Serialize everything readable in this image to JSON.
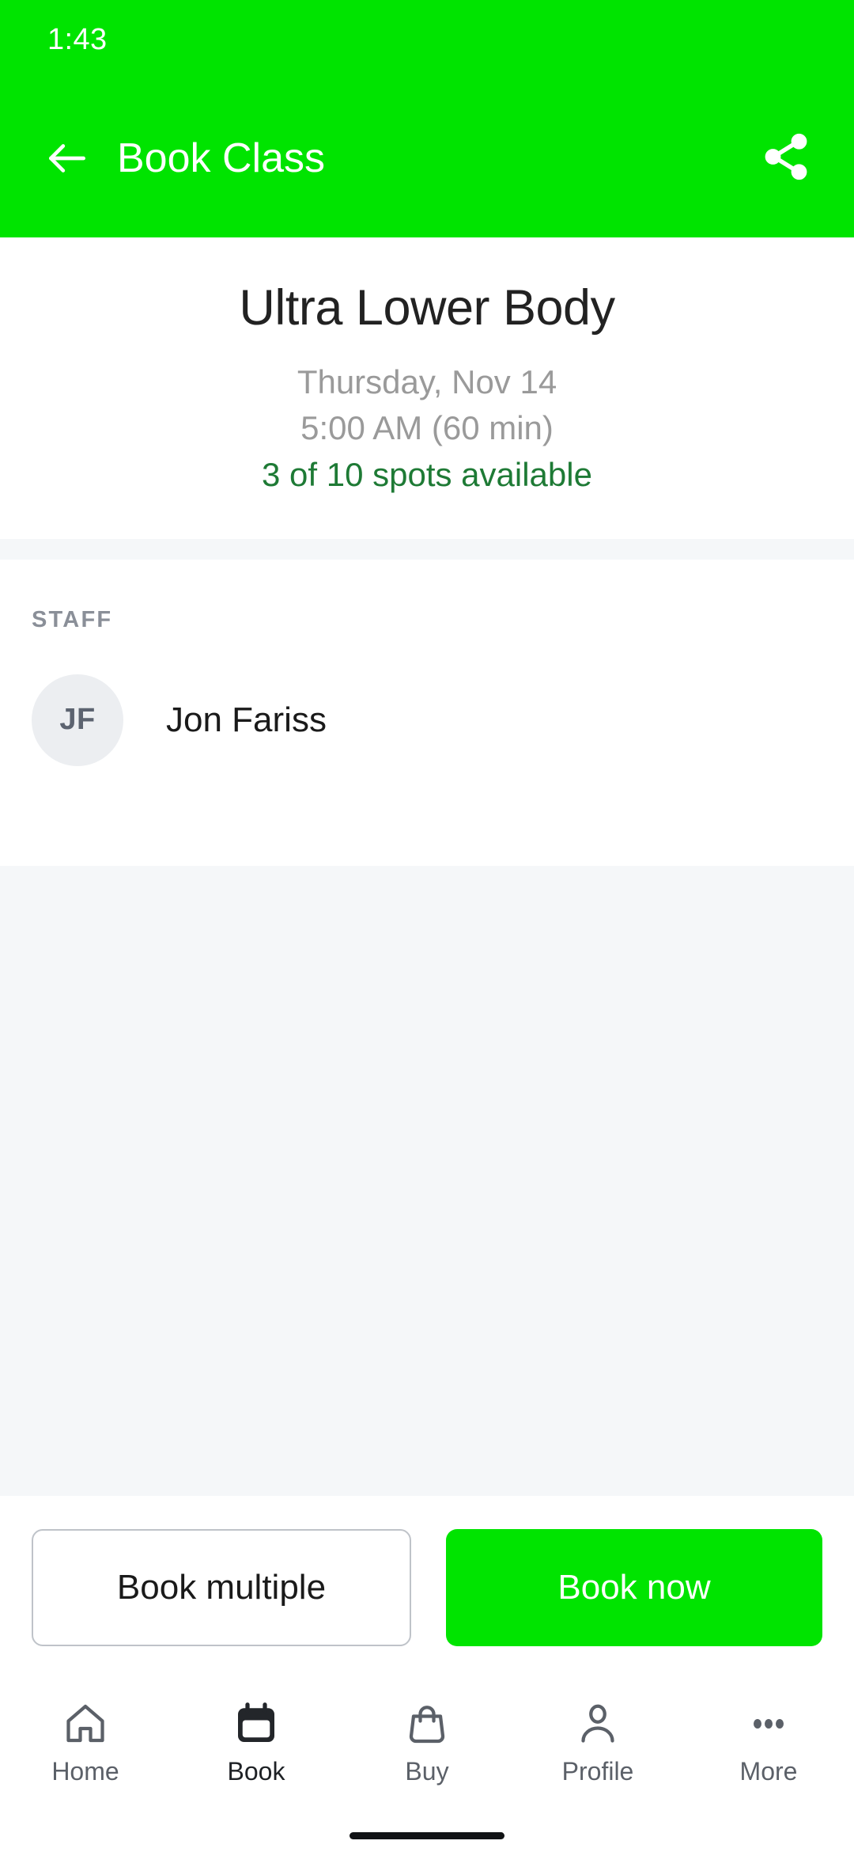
{
  "theme": {
    "brand_green": "#00E400",
    "spots_green": "#1E7A35",
    "section_gray": "#F5F7F9",
    "avatar_bg": "#ECEEF1"
  },
  "status_bar": {
    "time": "1:43"
  },
  "app_bar": {
    "back_icon": "arrow-left-icon",
    "title": "Book Class",
    "share_icon": "share-icon"
  },
  "class": {
    "title": "Ultra Lower Body",
    "date": "Thursday, Nov 14",
    "time": "5:00 AM (60 min)",
    "spots": "3 of 10 spots available"
  },
  "staff": {
    "section_label": "STAFF",
    "members": [
      {
        "initials": "JF",
        "name": "Jon Fariss"
      }
    ]
  },
  "actions": {
    "secondary_label": "Book multiple",
    "primary_label": "Book now"
  },
  "bottom_nav": {
    "items": [
      {
        "label": "Home",
        "icon": "home-icon",
        "active": false
      },
      {
        "label": "Book",
        "icon": "calendar-icon",
        "active": true
      },
      {
        "label": "Buy",
        "icon": "shopping-bag-icon",
        "active": false
      },
      {
        "label": "Profile",
        "icon": "person-icon",
        "active": false
      },
      {
        "label": "More",
        "icon": "ellipsis-icon",
        "active": false
      }
    ]
  }
}
